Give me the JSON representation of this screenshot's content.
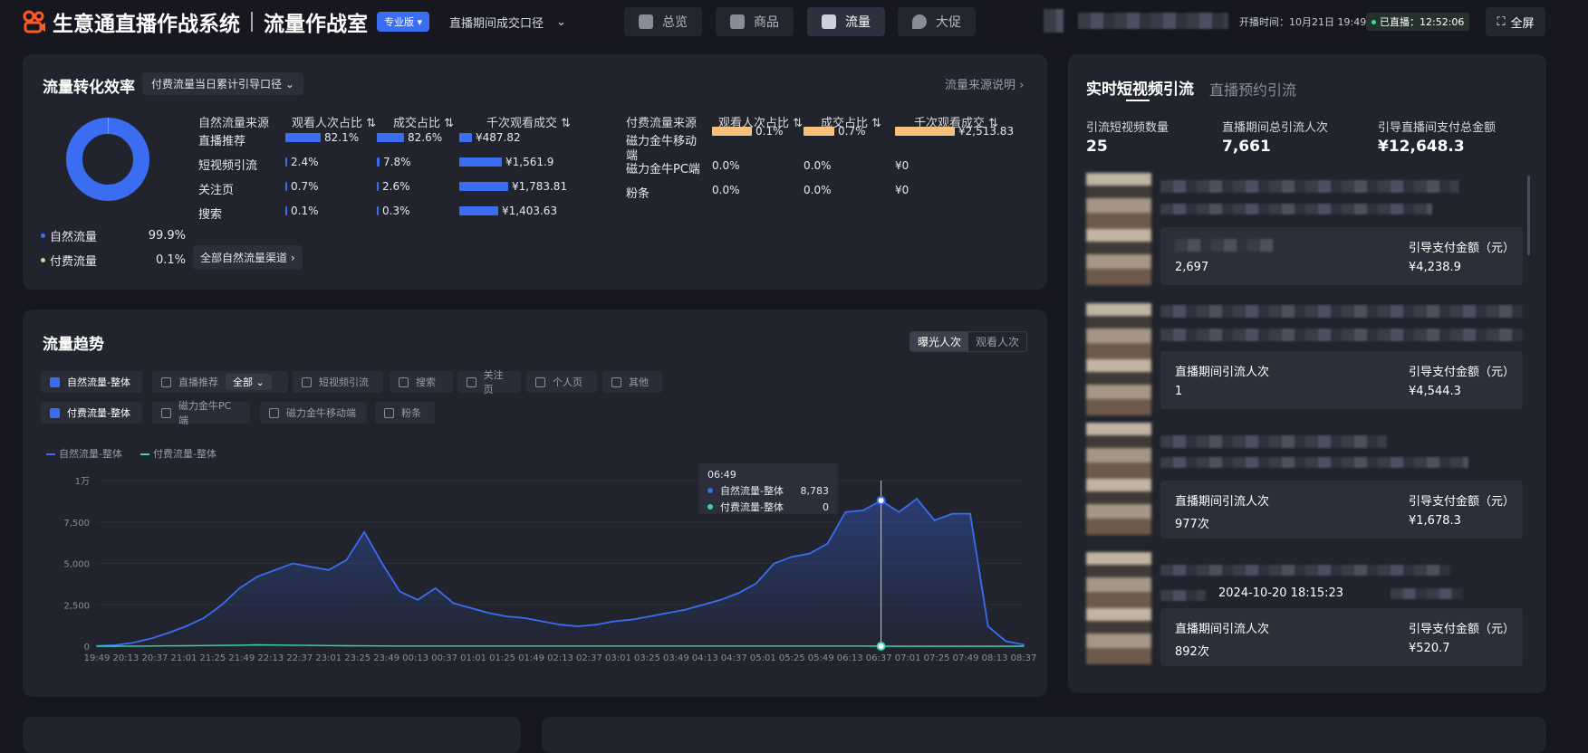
{
  "header": {
    "app_name": "生意通直播作战系统",
    "room_name": "流量作战室",
    "edition": "专业版",
    "caliber": "直播期间成交口径",
    "tabs": [
      {
        "label": "总览",
        "icon": "chart-icon",
        "active": false
      },
      {
        "label": "商品",
        "icon": "bag-icon",
        "active": false
      },
      {
        "label": "流量",
        "icon": "trend-icon",
        "active": true
      },
      {
        "label": "大促",
        "icon": "fire-icon",
        "active": false
      }
    ],
    "open_time": "开播时间：10月21日 19:49",
    "live_status": "已直播：12:52:06",
    "fullscreen_label": "全屏"
  },
  "conversion": {
    "title": "流量转化效率",
    "scope": "付费流量当日累计引导口径",
    "source_note": "流量来源说明",
    "legend": [
      {
        "label": "自然流量",
        "value": "99.9%",
        "color": "#3b6df2"
      },
      {
        "label": "付费流量",
        "value": "0.1%",
        "color": "#f9c27a"
      }
    ],
    "natural": {
      "headers": [
        "自然流量来源",
        "观看人次占比",
        "成交占比",
        "千次观看成交"
      ],
      "rows": [
        {
          "name": "直播推荐",
          "view": "82.1%",
          "view_pct": 82.1,
          "deal": "82.6%",
          "deal_pct": 82.6,
          "gmv": "¥487.82",
          "gmv_pct": 19
        },
        {
          "name": "短视频引流",
          "view": "2.4%",
          "view_pct": 2.4,
          "deal": "7.8%",
          "deal_pct": 7.8,
          "gmv": "¥1,561.9",
          "gmv_pct": 62
        },
        {
          "name": "关注页",
          "view": "0.7%",
          "view_pct": 0.7,
          "deal": "2.6%",
          "deal_pct": 2.6,
          "gmv": "¥1,783.81",
          "gmv_pct": 71
        },
        {
          "name": "搜索",
          "view": "0.1%",
          "view_pct": 0.1,
          "deal": "0.3%",
          "deal_pct": 0.3,
          "gmv": "¥1,403.63",
          "gmv_pct": 56
        }
      ],
      "all_button": "全部自然流量渠道"
    },
    "paid": {
      "headers": [
        "付费流量来源",
        "观看人次占比",
        "成交占比",
        "千次观看成交"
      ],
      "rows": [
        {
          "name": "磁力金牛移动端",
          "view": "0.1%",
          "view_pct": 100,
          "deal": "0.7%",
          "deal_pct": 100,
          "gmv": "¥2,513.83",
          "gmv_pct": 100
        },
        {
          "name": "磁力金牛PC端",
          "view": "0.0%",
          "view_pct": 0,
          "deal": "0.0%",
          "deal_pct": 0,
          "gmv": "¥0",
          "gmv_pct": 0
        },
        {
          "name": "粉条",
          "view": "0.0%",
          "view_pct": 0,
          "deal": "0.0%",
          "deal_pct": 0,
          "gmv": "¥0",
          "gmv_pct": 0
        }
      ]
    }
  },
  "trend": {
    "title": "流量趋势",
    "toggle": [
      "曝光人次",
      "观看人次"
    ],
    "filters_row1": [
      {
        "label": "自然流量-整体",
        "checked": true
      },
      {
        "label": "直播推荐",
        "checked": false,
        "dropdown": "全部"
      },
      {
        "label": "短视频引流",
        "checked": false
      },
      {
        "label": "搜索",
        "checked": false
      },
      {
        "label": "关注页",
        "checked": false
      },
      {
        "label": "个人页",
        "checked": false
      },
      {
        "label": "其他",
        "checked": false
      }
    ],
    "filters_row2": [
      {
        "label": "付费流量-整体",
        "checked": true
      },
      {
        "label": "磁力金牛PC端",
        "checked": false
      },
      {
        "label": "磁力金牛移动端",
        "checked": false
      },
      {
        "label": "粉条",
        "checked": false
      }
    ],
    "tooltip": {
      "time": "06:49",
      "rows": [
        {
          "name": "自然流量-整体",
          "value": "8,783",
          "color": "#3b6df2"
        },
        {
          "name": "付费流量-整体",
          "value": "0",
          "color": "#3ad3b8"
        }
      ]
    }
  },
  "chart_data": {
    "type": "area",
    "ylim": [
      0,
      10000
    ],
    "yticks": [
      "0",
      "2,500",
      "5,000",
      "7,500",
      "1万"
    ],
    "xticks": [
      "19:49",
      "20:13",
      "20:37",
      "21:01",
      "21:25",
      "21:49",
      "22:13",
      "22:37",
      "23:01",
      "23:25",
      "23:49",
      "00:13",
      "00:37",
      "01:01",
      "01:25",
      "01:49",
      "02:13",
      "02:37",
      "03:01",
      "03:25",
      "03:49",
      "04:13",
      "04:37",
      "05:01",
      "05:25",
      "05:49",
      "06:13",
      "06:37",
      "07:01",
      "07:25",
      "07:49",
      "08:13",
      "08:37"
    ],
    "series": [
      {
        "name": "自然流量-整体",
        "color": "#3b6df2",
        "values": [
          20,
          60,
          200,
          450,
          800,
          1200,
          1700,
          2500,
          3500,
          4200,
          4600,
          5000,
          4800,
          4600,
          5200,
          6900,
          5000,
          3300,
          2800,
          3500,
          2600,
          2300,
          2000,
          1800,
          1700,
          1500,
          1300,
          1200,
          1300,
          1500,
          1600,
          1800,
          2000,
          2200,
          2500,
          2800,
          3200,
          3800,
          5000,
          5400,
          5600,
          6200,
          8100,
          8200,
          8800,
          8100,
          8900,
          7600,
          8000,
          8000,
          1200,
          300,
          100
        ]
      },
      {
        "name": "付费流量-整体",
        "color": "#3ad3b8",
        "values": [
          0,
          0,
          5,
          10,
          20,
          30,
          40,
          50,
          60,
          80,
          70,
          60,
          50,
          40,
          30,
          20,
          15,
          10,
          10,
          10,
          10,
          10,
          10,
          10,
          10,
          10,
          10,
          10,
          10,
          10,
          10,
          10,
          10,
          10,
          10,
          10,
          10,
          10,
          10,
          10,
          10,
          10,
          10,
          10,
          0,
          0,
          0,
          0,
          0,
          0,
          0,
          0,
          0
        ]
      }
    ]
  },
  "videos": {
    "tabs": [
      "实时短视频引流",
      "直播预约引流"
    ],
    "summary": [
      {
        "label": "引流短视频数量",
        "value": "25"
      },
      {
        "label": "直播期间总引流人次",
        "value": "7,661"
      },
      {
        "label": "引导直播间支付总金额",
        "value": "¥12,648.3"
      }
    ],
    "cards": [
      {
        "left_label": "",
        "left_value": "2,697",
        "right_label": "引导支付金额（元）",
        "right_value": "¥4,238.9",
        "meta": ""
      },
      {
        "left_label": "直播期间引流人次",
        "left_value": "1",
        "right_label": "引导支付金额（元）",
        "right_value": "¥4,544.3",
        "meta": ""
      },
      {
        "left_label": "直播期间引流人次",
        "left_value": "977次",
        "right_label": "引导支付金额（元）",
        "right_value": "¥1,678.3",
        "meta": ""
      },
      {
        "left_label": "直播期间引流人次",
        "left_value": "892次",
        "right_label": "引导支付金额（元）",
        "right_value": "¥520.7",
        "meta": "2024-10-20 18:15:23"
      }
    ]
  }
}
